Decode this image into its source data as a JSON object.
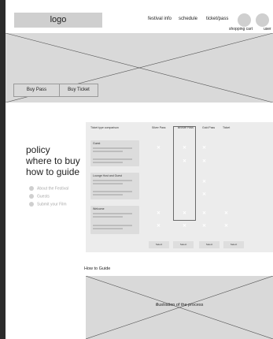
{
  "header": {
    "logo": "logo",
    "nav": [
      "festival info",
      "schedule",
      "ticket/pass"
    ],
    "cart_label": "shopping cart",
    "user_label": "user"
  },
  "hero": {
    "buy_pass": "Buy Pass",
    "buy_ticket": "Buy Ticket"
  },
  "left": {
    "title_lines": [
      "policy",
      "where to buy",
      "how to guide"
    ],
    "items": [
      "About the Festival",
      "Guests",
      "Submit your Film"
    ]
  },
  "comparison": {
    "title": "Ticket type comparison",
    "columns": [
      "Silver Pass",
      "Bronze Pass",
      "Gold Pass",
      "Ticket"
    ],
    "tiers": [
      "Guest",
      "Lounge Host and Guest",
      "Welcome"
    ],
    "select_labels": [
      "Select",
      "Select",
      "Select",
      "Select"
    ]
  },
  "guide": {
    "heading": "How to Guide",
    "caption": "illustration of the process"
  },
  "colors": {
    "placeholder": "#d9d9d9",
    "panel": "#ececec",
    "highlight_border": "#6a6a6a"
  }
}
